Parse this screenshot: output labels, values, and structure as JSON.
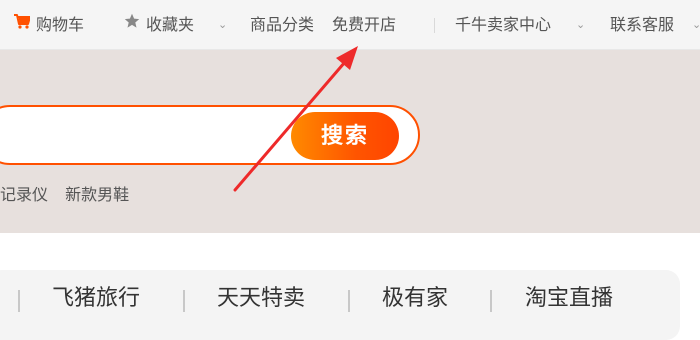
{
  "topbar": {
    "cart": {
      "label": "购物车",
      "icon": "cart-icon"
    },
    "favorites": {
      "label": "收藏夹",
      "icon": "star-icon"
    },
    "categories": {
      "label": "商品分类"
    },
    "free_shop": {
      "label": "免费开店"
    },
    "seller_center": {
      "label": "千牛卖家中心"
    },
    "customer_service": {
      "label": "联系客服"
    }
  },
  "search": {
    "button_label": "搜索",
    "input_value": "",
    "hot_words": [
      "记录仪",
      "新款男鞋"
    ]
  },
  "nav": {
    "items": [
      "飞猪旅行",
      "天天特卖",
      "极有家",
      "淘宝直播"
    ]
  },
  "colors": {
    "accent": "#ff5000",
    "header_bg": "#e7e0dd",
    "annotation_arrow": "#ee2a2a"
  }
}
